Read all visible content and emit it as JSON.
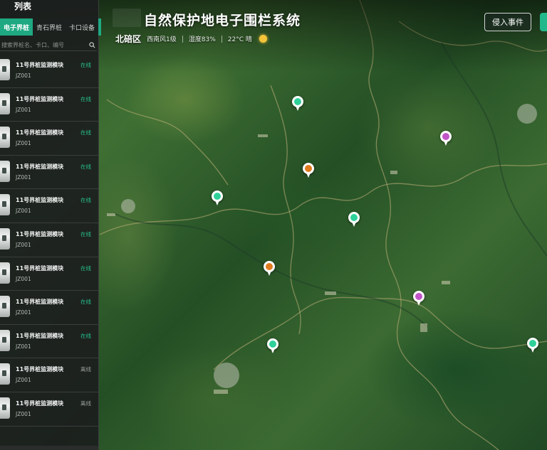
{
  "header": {
    "title": "自然保护地电子围栏系统",
    "district": "北碚区",
    "wind": "西南风1级",
    "humidity": "湿度83%",
    "temperature": "22°C 晴",
    "weather_icon": "sun-icon",
    "event_button": "侵入事件"
  },
  "sidebar": {
    "title": "列表",
    "tabs": [
      {
        "label": "电子界桩",
        "active": true
      },
      {
        "label": "青石界桩",
        "active": false
      },
      {
        "label": "卡口设备",
        "active": false
      }
    ],
    "search_placeholder": "搜索界桩名、卡口、编号",
    "items": [
      {
        "name": "11号界桩监测模块",
        "code": "JZ001",
        "status": "在线"
      },
      {
        "name": "11号界桩监测模块",
        "code": "JZ001",
        "status": "在线"
      },
      {
        "name": "11号界桩监测模块",
        "code": "JZ001",
        "status": "在线"
      },
      {
        "name": "11号界桩监测模块",
        "code": "JZ001",
        "status": "在线"
      },
      {
        "name": "11号界桩监测模块",
        "code": "JZ001",
        "status": "在线"
      },
      {
        "name": "11号界桩监测模块",
        "code": "JZ001",
        "status": "在线"
      },
      {
        "name": "11号界桩监测模块",
        "code": "JZ001",
        "status": "在线"
      },
      {
        "name": "11号界桩监测模块",
        "code": "JZ001",
        "status": "在线"
      },
      {
        "name": "11号界桩监测模块",
        "code": "JZ001",
        "status": "在线"
      },
      {
        "name": "11号界桩监测模块",
        "code": "JZ001",
        "status": "离线"
      },
      {
        "name": "11号界桩监测模块",
        "code": "JZ001",
        "status": "离线"
      }
    ]
  },
  "colors": {
    "online": "#27c28e",
    "offline": "#9aa09d",
    "accent": "#1fa982"
  },
  "markers": [
    {
      "type": "online",
      "color": "#2fd19a"
    },
    {
      "type": "warning",
      "color": "#e07b1f"
    },
    {
      "type": "alert",
      "color": "#c254c8"
    },
    {
      "type": "online",
      "color": "#2fd19a"
    },
    {
      "type": "online",
      "color": "#2fd19a"
    },
    {
      "type": "warning",
      "color": "#e07b1f"
    },
    {
      "type": "alert",
      "color": "#c254c8"
    },
    {
      "type": "online",
      "color": "#2fd19a"
    },
    {
      "type": "online",
      "color": "#2fd19a"
    }
  ]
}
